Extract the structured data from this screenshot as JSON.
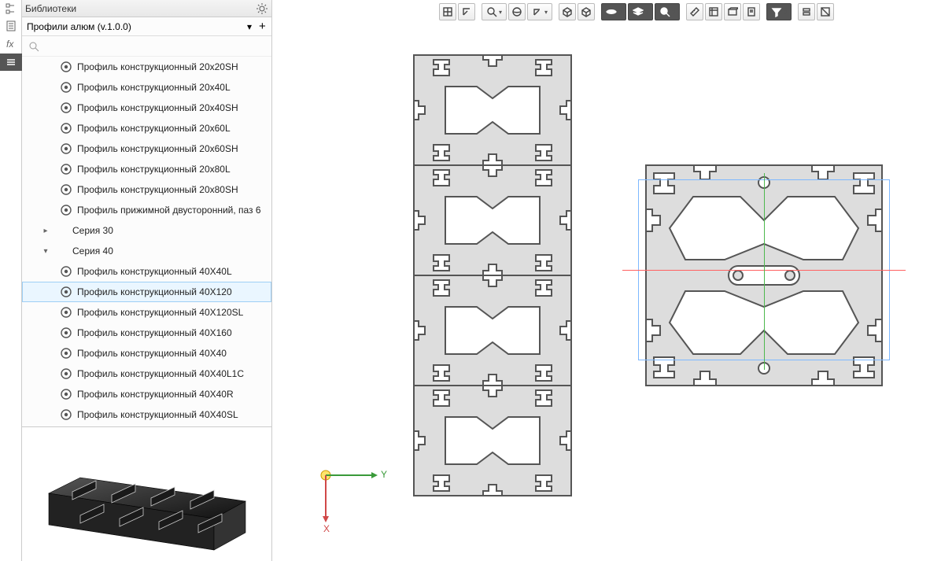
{
  "sidebar": {
    "panel_title": "Библиотеки",
    "library_name": "Профили алюм (v.1.0.0)",
    "items": [
      {
        "label": "Профиль конструкционный 20x20SH",
        "kind": "item"
      },
      {
        "label": "Профиль конструкционный 20x40L",
        "kind": "item"
      },
      {
        "label": "Профиль конструкционный 20x40SH",
        "kind": "item"
      },
      {
        "label": "Профиль конструкционный 20x60L",
        "kind": "item"
      },
      {
        "label": "Профиль конструкционный 20x60SH",
        "kind": "item"
      },
      {
        "label": "Профиль конструкционный 20x80L",
        "kind": "item"
      },
      {
        "label": "Профиль конструкционный 20x80SH",
        "kind": "item"
      },
      {
        "label": "Профиль прижимной двусторонний, паз 6",
        "kind": "item"
      },
      {
        "label": "Серия 30",
        "kind": "folder",
        "expanded": false
      },
      {
        "label": "Серия 40",
        "kind": "folder",
        "expanded": true
      },
      {
        "label": "Профиль конструкционный 40X40L",
        "kind": "item"
      },
      {
        "label": "Профиль конструкционный 40X120",
        "kind": "item",
        "selected": true
      },
      {
        "label": "Профиль конструкционный 40X120SL",
        "kind": "item"
      },
      {
        "label": "Профиль конструкционный 40X160",
        "kind": "item"
      },
      {
        "label": "Профиль конструкционный 40X40",
        "kind": "item"
      },
      {
        "label": "Профиль конструкционный 40X40L1C",
        "kind": "item"
      },
      {
        "label": "Профиль конструкционный 40X40R",
        "kind": "item"
      },
      {
        "label": "Профиль конструкционный 40X40SL",
        "kind": "item"
      }
    ]
  },
  "canvas": {
    "triad": {
      "x_label": "X",
      "y_label": "Y"
    }
  },
  "toolbar": {
    "groups": [
      [
        "grid",
        "ucs"
      ],
      [
        "zoom-region",
        "drop",
        "orbit",
        "ucs2",
        "drop"
      ],
      [
        "cube",
        "wire"
      ],
      [
        "eye",
        "drop",
        "layers",
        "drop",
        "search",
        "drop"
      ],
      [
        "measure",
        "align",
        "box",
        "sheet"
      ],
      [
        "filter",
        "drop"
      ],
      [
        "stack",
        "clip"
      ]
    ]
  }
}
